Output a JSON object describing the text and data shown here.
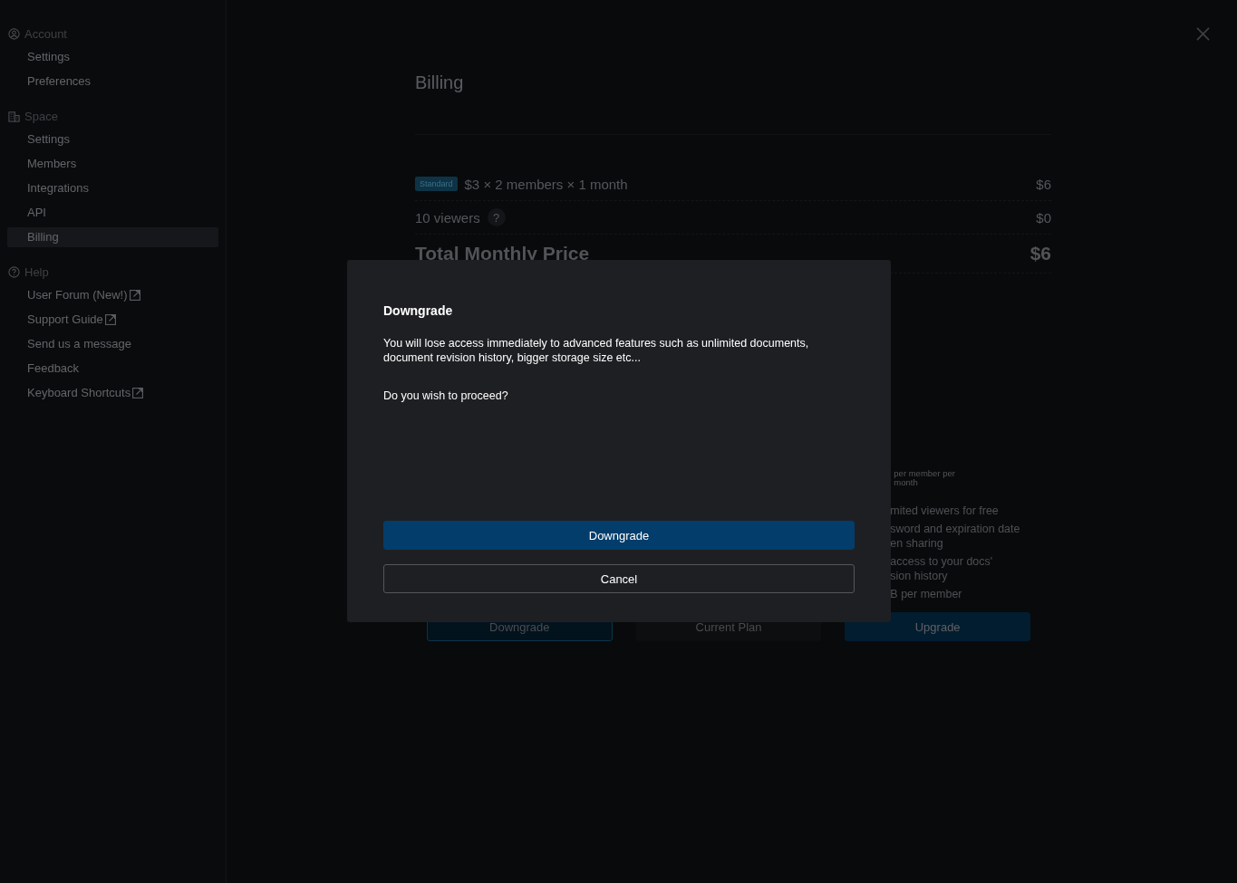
{
  "sidebar": {
    "sections": [
      {
        "title": "Account",
        "items": [
          {
            "label": "Settings",
            "selected": false,
            "external": false
          },
          {
            "label": "Preferences",
            "selected": false,
            "external": false
          }
        ]
      },
      {
        "title": "Space",
        "items": [
          {
            "label": "Settings",
            "selected": false,
            "external": false
          },
          {
            "label": "Members",
            "selected": false,
            "external": false
          },
          {
            "label": "Integrations",
            "selected": false,
            "external": false
          },
          {
            "label": "API",
            "selected": false,
            "external": false
          },
          {
            "label": "Billing",
            "selected": true,
            "external": false
          }
        ]
      },
      {
        "title": "Help",
        "items": [
          {
            "label": "User Forum (New!)",
            "selected": false,
            "external": true
          },
          {
            "label": "Support Guide",
            "selected": false,
            "external": true
          },
          {
            "label": "Send us a message",
            "selected": false,
            "external": false
          },
          {
            "label": "Feedback",
            "selected": false,
            "external": false
          },
          {
            "label": "Keyboard Shortcuts",
            "selected": false,
            "external": true
          }
        ]
      }
    ]
  },
  "page": {
    "title": "Billing",
    "lines": [
      {
        "badge": "Standard",
        "label": "$3 × 2 members × 1 month",
        "amount": "$6"
      },
      {
        "label": "10 viewers",
        "help_mark": "?",
        "amount": "$0"
      }
    ],
    "total": {
      "label": "Total Monthly Price",
      "amount": "$6"
    },
    "plan_note": [
      "per member per",
      "month"
    ],
    "plan_features": [
      "mited viewers for free",
      "sword and expiration date",
      "en sharing",
      "access to your docs'",
      "sion history",
      "B per member"
    ],
    "plan_buttons": [
      {
        "label": "Downgrade",
        "kind": "outline"
      },
      {
        "label": "Current Plan",
        "kind": "muted"
      },
      {
        "label": "Upgrade",
        "kind": "primary"
      }
    ]
  },
  "dialog": {
    "title": "Downgrade",
    "message": "You will lose access immediately to advanced features such as unlimited documents, document revision history, bigger storage size etc...",
    "question": "Do you wish to proceed?",
    "confirm": "Downgrade",
    "cancel": "Cancel"
  }
}
